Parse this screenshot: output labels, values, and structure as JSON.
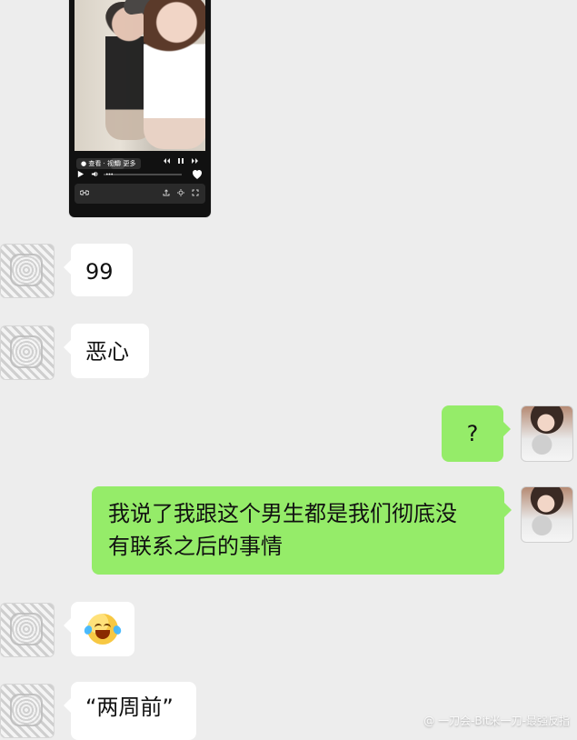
{
  "messages": [
    {
      "id": "m1",
      "text": "99"
    },
    {
      "id": "m2",
      "text": "恶心"
    },
    {
      "id": "m3",
      "text": "?"
    },
    {
      "id": "m4",
      "text": "我说了我跟这个男生都是我们彻底没\n有联系之后的事情"
    },
    {
      "id": "m5",
      "emoji": "tears-of-joy"
    },
    {
      "id": "m6",
      "text": "“两周前”"
    }
  ],
  "video_preview": {
    "chip1": "● 查看 · 视频",
    "chip2": "☐ 更多",
    "progress": 0.0
  },
  "watermark": {
    "text": "@ 一刀会-Bit米一刀-最强反指"
  },
  "colors": {
    "background": "#ededed",
    "bubble_white": "#ffffff",
    "bubble_green": "#95ec69",
    "text": "#111111"
  },
  "icons": [
    "avatar-left",
    "avatar-right",
    "play-icon",
    "heart-icon",
    "laughing-emoji-icon"
  ]
}
